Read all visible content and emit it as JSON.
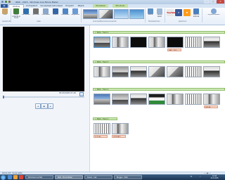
{
  "window": {
    "title": "IRAK - 2015 - Windows Live Movie Maker",
    "min": "–",
    "max": "□",
    "close": "✕"
  },
  "tabs": [
    "Aloitus",
    "Animaatiot",
    "Visuaaliset tehosteet",
    "Projekti",
    "Näytä",
    "Muokkaa",
    "Muotoilu"
  ],
  "ribbon": {
    "groups": [
      "Leikepöytä",
      "Lisää",
      "Automaattiset elokuva-teemat",
      "Muokkaaminen",
      "Jakaminen"
    ],
    "buttons": {
      "paste": "Liitä",
      "add_videos": "Lisää videoita ja kuvia",
      "webcam": "Verkkokameravideo",
      "narration": "Kerronta",
      "snapshot": "Tilannevedos",
      "title": "Otsikko",
      "caption": "Kuvateksti",
      "credits": "Tekijätiedot",
      "rotate": "Kierrä",
      "select_all": "Valitse kaikki",
      "save_movie": "Tallenna elokuva",
      "sign_in": "Kirjaudu sisään"
    },
    "social": [
      "YouTube",
      "f"
    ]
  },
  "preview": {
    "timecode": "00:00,00/04:37,00",
    "controls": [
      "◂",
      "▶",
      "▸"
    ]
  },
  "storyboard": {
    "tracks": [
      "♫ IRAK - Track 2",
      "♫ IRAK - Track 3",
      "♫ IRAK - Track 4",
      "♫ IRAK - Track 4"
    ],
    "captions": [
      "IRAK - 2015",
      "KENGÄ...",
      "SOTILAS",
      "HYÖKKÄYS"
    ]
  },
  "status": {
    "left": "Kohde 1/15 · Kuvaa valittu",
    "zoom": "───●─── "
  },
  "taskbar": {
    "tasks": [
      "Windows Live Mail",
      "IRAK - Movie Maker",
      "Kansio - Irak",
      "Blogger - IRAK"
    ],
    "lang": "FI",
    "time": "12:44",
    "date": "14.3.2015"
  }
}
